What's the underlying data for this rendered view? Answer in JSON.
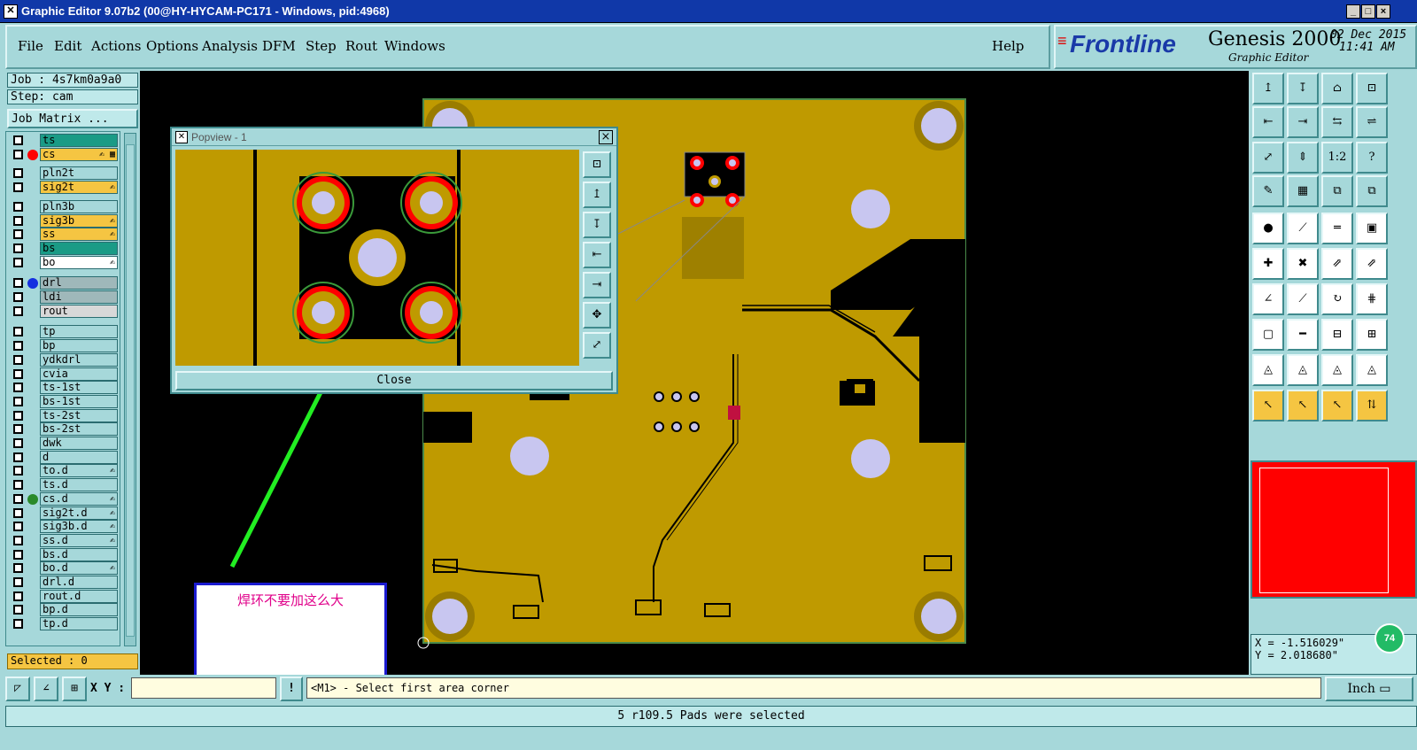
{
  "window": {
    "title": "Graphic Editor 9.07b2 (00@HY-HYCAM-PC171 - Windows, pid:4968)",
    "btn_min": "_",
    "btn_max": "□",
    "btn_close": "×"
  },
  "menu": [
    "File",
    "Edit",
    "Actions",
    "Options",
    "Analysis",
    "DFM",
    "Step",
    "Rout",
    "Windows"
  ],
  "help": "Help",
  "brand": {
    "logo": "Frontline",
    "product": "Genesis 2000",
    "subtitle": "Graphic Editor",
    "date": "02 Dec 2015",
    "time": "11:41 AM"
  },
  "job": {
    "job": "Job : 4s7km0a9a0",
    "step": "Step: cam",
    "matrix": "Job Matrix ..."
  },
  "layers": [
    {
      "name": "ts",
      "dot": "",
      "bg": "#1a9b86",
      "mark": ""
    },
    {
      "name": "cs",
      "dot": "#ff0000",
      "bg": "#f5c542",
      "mark": "✍ ▦"
    },
    {
      "name": "pln2t",
      "dot": "",
      "bg": "",
      "mark": ""
    },
    {
      "name": "sig2t",
      "dot": "",
      "bg": "#f5c542",
      "mark": "✍"
    },
    {
      "name": "pln3b",
      "dot": "",
      "bg": "",
      "mark": ""
    },
    {
      "name": "sig3b",
      "dot": "",
      "bg": "#f5c542",
      "mark": "✍"
    },
    {
      "name": "ss",
      "dot": "",
      "bg": "#f5c542",
      "mark": "✍"
    },
    {
      "name": "bs",
      "dot": "",
      "bg": "#1a9b86",
      "mark": ""
    },
    {
      "name": "bo",
      "dot": "",
      "bg": "#ffffff",
      "mark": "✍"
    },
    {
      "name": "drl",
      "dot": "#1530e0",
      "bg": "#9fb8ba",
      "mark": ""
    },
    {
      "name": "ldi",
      "dot": "",
      "bg": "#9fb8ba",
      "mark": ""
    },
    {
      "name": "rout",
      "dot": "",
      "bg": "#d8d8d8",
      "mark": ""
    },
    {
      "name": "tp",
      "dot": "",
      "bg": "",
      "mark": ""
    },
    {
      "name": "bp",
      "dot": "",
      "bg": "",
      "mark": ""
    },
    {
      "name": "ydkdrl",
      "dot": "",
      "bg": "",
      "mark": ""
    },
    {
      "name": "cvia",
      "dot": "",
      "bg": "",
      "mark": ""
    },
    {
      "name": "ts-1st",
      "dot": "",
      "bg": "",
      "mark": ""
    },
    {
      "name": "bs-1st",
      "dot": "",
      "bg": "",
      "mark": ""
    },
    {
      "name": "ts-2st",
      "dot": "",
      "bg": "",
      "mark": ""
    },
    {
      "name": "bs-2st",
      "dot": "",
      "bg": "",
      "mark": ""
    },
    {
      "name": "dwk",
      "dot": "",
      "bg": "",
      "mark": ""
    },
    {
      "name": "d",
      "dot": "",
      "bg": "",
      "mark": ""
    },
    {
      "name": "to.d",
      "dot": "",
      "bg": "",
      "mark": "✍"
    },
    {
      "name": "ts.d",
      "dot": "",
      "bg": "",
      "mark": ""
    },
    {
      "name": "cs.d",
      "dot": "#2a8a2a",
      "bg": "",
      "mark": "✍"
    },
    {
      "name": "sig2t.d",
      "dot": "",
      "bg": "",
      "mark": "✍"
    },
    {
      "name": "sig3b.d",
      "dot": "",
      "bg": "",
      "mark": "✍"
    },
    {
      "name": "ss.d",
      "dot": "",
      "bg": "",
      "mark": "✍"
    },
    {
      "name": "bs.d",
      "dot": "",
      "bg": "",
      "mark": ""
    },
    {
      "name": "bo.d",
      "dot": "",
      "bg": "",
      "mark": "✍"
    },
    {
      "name": "drl.d",
      "dot": "",
      "bg": "",
      "mark": ""
    },
    {
      "name": "rout.d",
      "dot": "",
      "bg": "",
      "mark": ""
    },
    {
      "name": "bp.d",
      "dot": "",
      "bg": "",
      "mark": ""
    },
    {
      "name": "tp.d",
      "dot": "",
      "bg": "",
      "mark": ""
    }
  ],
  "selected": "Selected : 0",
  "popview": {
    "title": "Popview - 1",
    "close": "Close",
    "x": "×"
  },
  "annotation": "焊环不要加这么大",
  "coords": {
    "x": "X = -1.516029\"",
    "y": "Y = 2.018680\"",
    "zoom": "74"
  },
  "cmd": {
    "xy_label": "X Y :",
    "xy_value": "",
    "prompt": "<M1> - Select first area corner",
    "excl": "!",
    "unit": "Inch"
  },
  "status": "5 r109.5 Pads were selected",
  "tools": [
    "↥",
    "↧",
    "⌂",
    "⊡",
    "⇤",
    "⇥",
    "⇆",
    "⇌",
    "⤢",
    "⇕",
    "1:2",
    "?",
    "✎",
    "▦",
    "⧉",
    "⧉",
    "●",
    "⟋",
    "═",
    "▣",
    "✚",
    "✖",
    "⇗",
    "⇗",
    "∠",
    "⟋",
    "↻",
    "⋕",
    "▢",
    "━",
    "⊟",
    "⊞",
    "◬",
    "◬",
    "◬",
    "◬",
    "↖",
    "↖",
    "↖",
    "⇅"
  ],
  "colors": {
    "board": "#bf9a00",
    "pad": "#c8c6f0",
    "copper": "#b58a10",
    "red": "#ff0000",
    "green_arrow": "#22ee22",
    "preview": "#ff0000"
  }
}
